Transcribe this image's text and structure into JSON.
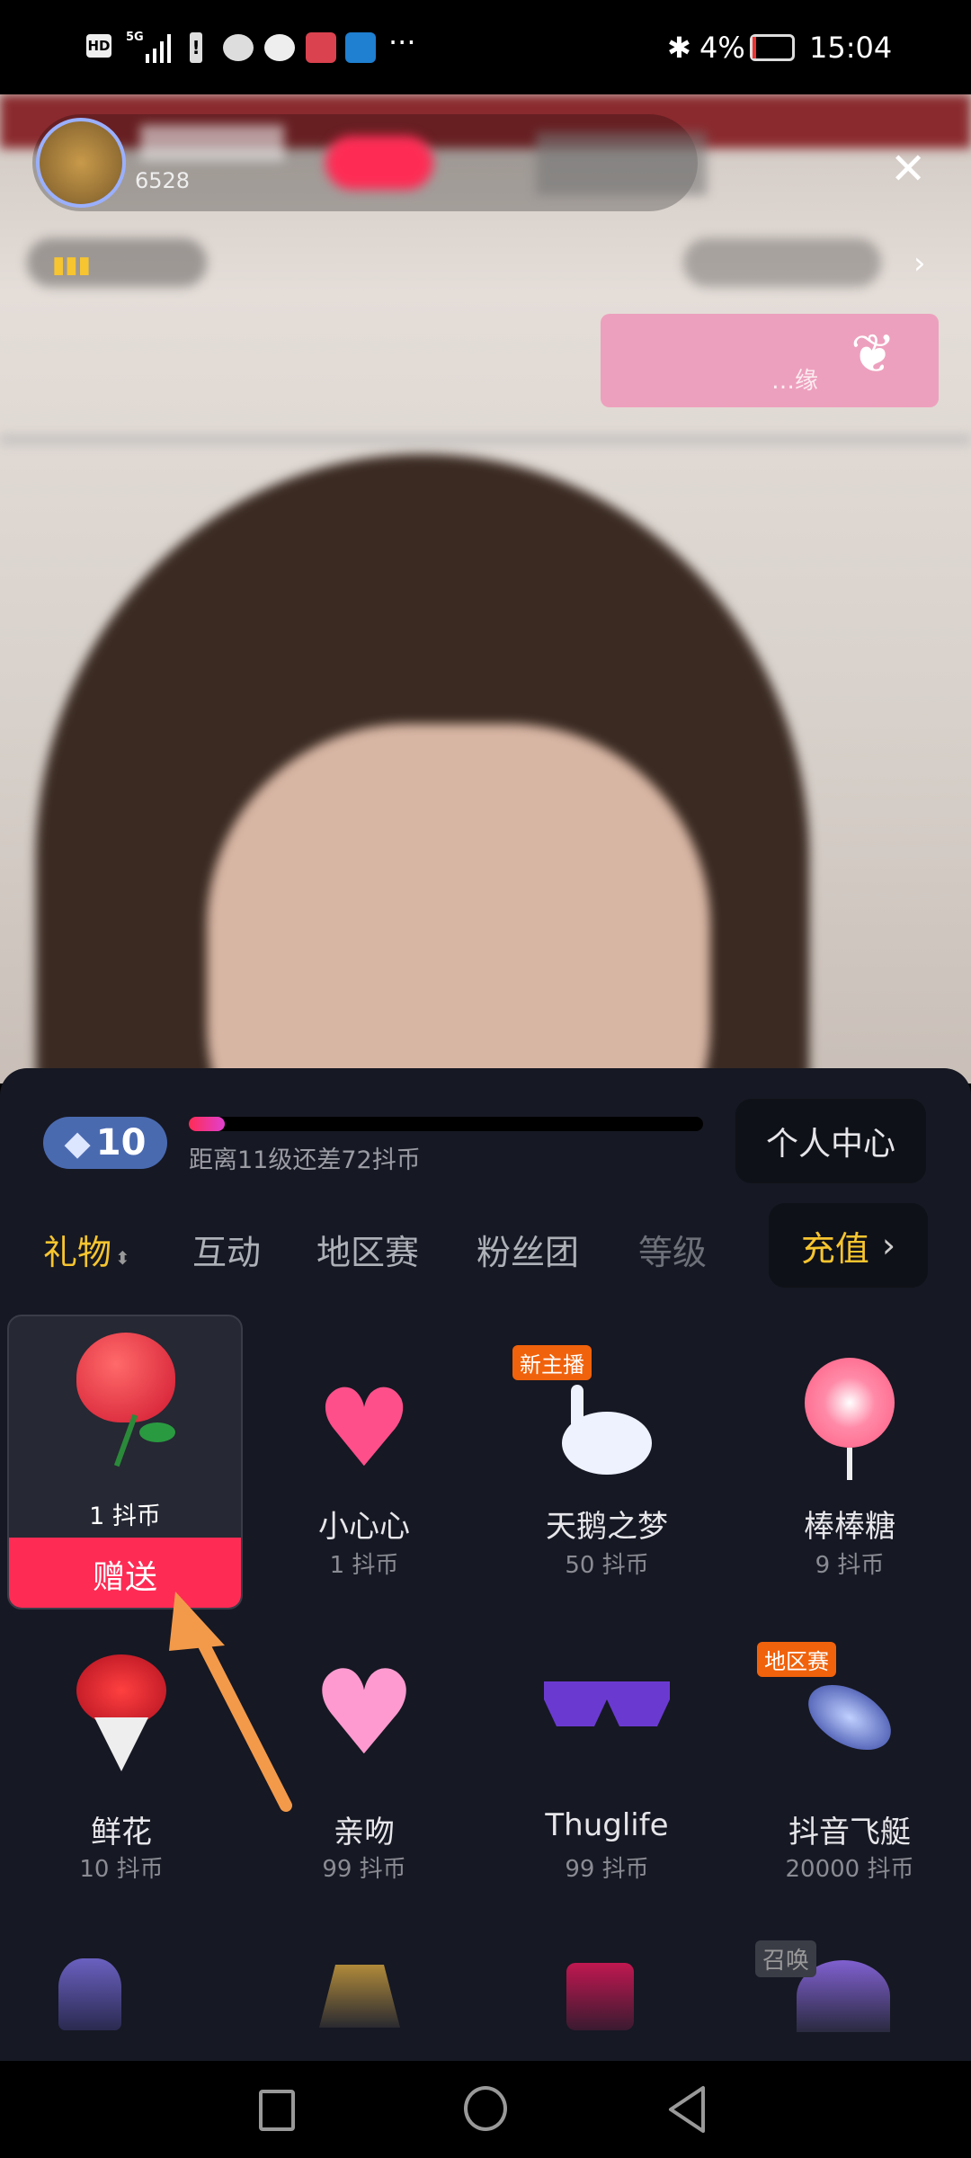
{
  "status_bar": {
    "left_icons": [
      "hd-icon",
      "5g-signal-icon",
      "battery-alert-icon",
      "wechat-icon",
      "message-icon",
      "book-app-icon",
      "weather-app-icon",
      "more-icon"
    ],
    "battery": "4%",
    "time": "15:04"
  },
  "live": {
    "viewer_count": "6528",
    "close_icon": "close-icon",
    "side_text": "…缘"
  },
  "panel": {
    "level": "10",
    "level_progress": 0.07,
    "level_tip": "距离11级还差72抖币",
    "personal_center": "个人中心",
    "tabs": [
      {
        "label": "礼物",
        "active": true
      },
      {
        "label": "互动"
      },
      {
        "label": "地区赛"
      },
      {
        "label": "粉丝团"
      },
      {
        "label": "等级"
      }
    ],
    "recharge": "充值",
    "gifts": [
      {
        "name": "玫瑰",
        "price": "1 抖币",
        "selected": true,
        "send": "赠送"
      },
      {
        "name": "小心心",
        "price": "1 抖币"
      },
      {
        "name": "天鹅之梦",
        "price": "50 抖币",
        "badge": "新主播"
      },
      {
        "name": "棒棒糖",
        "price": "9 抖币"
      },
      {
        "name": "鲜花",
        "price": "10 抖币"
      },
      {
        "name": "亲吻",
        "price": "99 抖币"
      },
      {
        "name": "Thuglife",
        "price": "99 抖币"
      },
      {
        "name": "抖音飞艇",
        "price": "20000 抖币",
        "badge": "地区赛"
      }
    ],
    "row3_badge": "召唤"
  },
  "colors": {
    "accent": "#fe2c55",
    "gold": "#f7c52f",
    "panel": "#161823",
    "arrow": "#f39a4a"
  }
}
